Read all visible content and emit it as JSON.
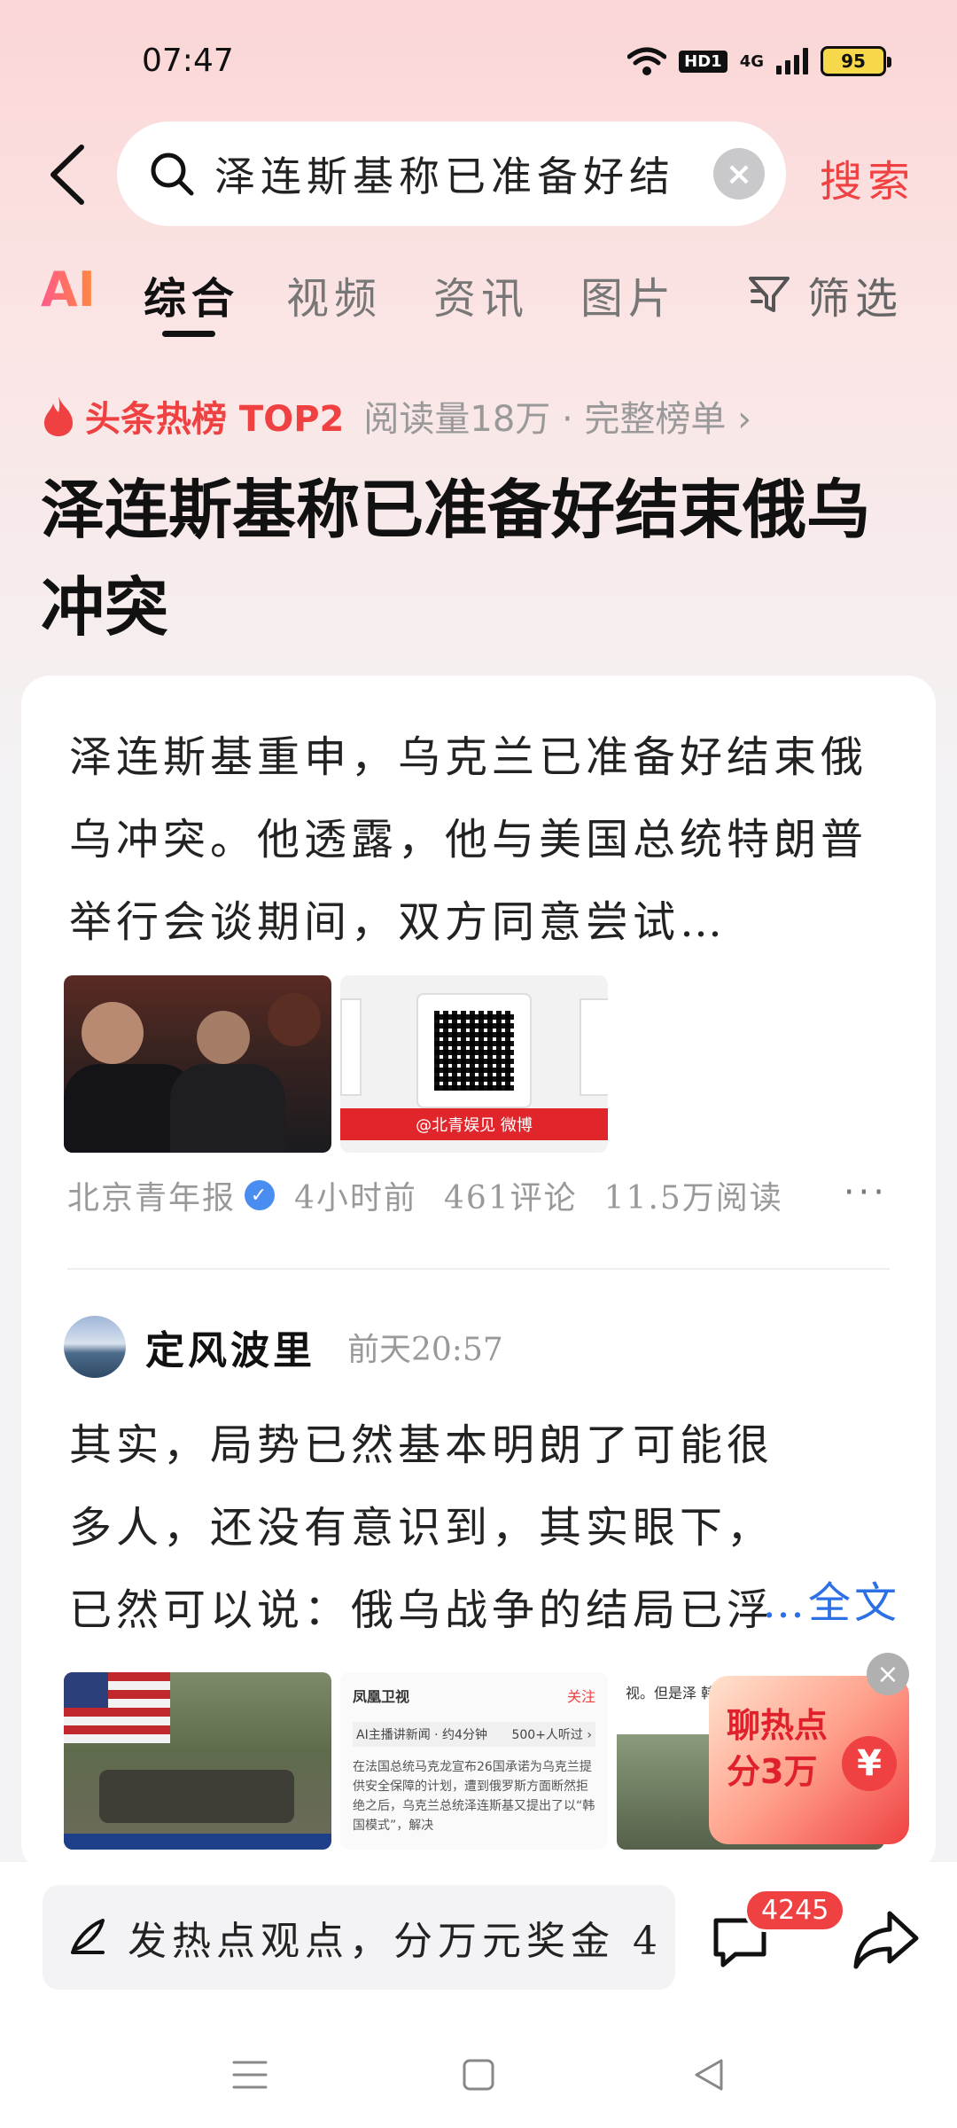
{
  "status_bar": {
    "time": "07:47",
    "hd_label": "HD1",
    "network_label": "4G",
    "battery_level": "95"
  },
  "search": {
    "query": "泽连斯基称已准备好结",
    "submit_label": "搜索"
  },
  "tabs": {
    "ai_label": "AI",
    "items": [
      "综合",
      "视频",
      "资讯",
      "图片"
    ],
    "active": "综合",
    "filter_label": "筛选"
  },
  "hot": {
    "tag": "头条热榜 TOP2",
    "meta": "阅读量18万 · 完整榜单 ›",
    "headline": "泽连斯基称已准备好结束俄乌冲突"
  },
  "post1": {
    "text": "泽连斯基重申，乌克兰已准备好结束俄乌冲突。他透露，他与美国总统特朗普举行会谈期间，双方同意尝试…",
    "image_caption": "@北青娱见 微博",
    "source": "北京青年报",
    "time": "4小时前",
    "comments": "461评论",
    "reads": "11.5万阅读",
    "more": "···"
  },
  "post2": {
    "author": "定风波里",
    "time": "前天20:57",
    "text": "其实，局势已然基本明朗了可能很多人，还没有意识到，其实眼下，已然可以说：俄乌战争的结局已浮",
    "more_label": "…全文",
    "thumb2_brand": "凤凰卫视",
    "thumb2_follow": "关注",
    "thumb2_audio": "AI主播讲新闻 · 约4分钟",
    "thumb2_listeners": "500+人听过 ›",
    "thumb2_body": "在法国总统马克龙宣布26国承诺为乌克兰提供安全保障的计划，遭到俄罗斯方面断然拒绝之后，乌克兰总统泽连斯基又提出了以“韩国模式”，解决",
    "thumb3_text": "视。但是泽 韩国安全模"
  },
  "promo": {
    "line1": "聊热点",
    "line2": "分3万",
    "coin": "¥"
  },
  "bottom": {
    "comment_placeholder": "发热点观点，分万元奖金 4.",
    "comment_count": "4245"
  },
  "colors": {
    "accent": "#f04142",
    "link": "#2d6fe4",
    "muted": "#999999"
  }
}
